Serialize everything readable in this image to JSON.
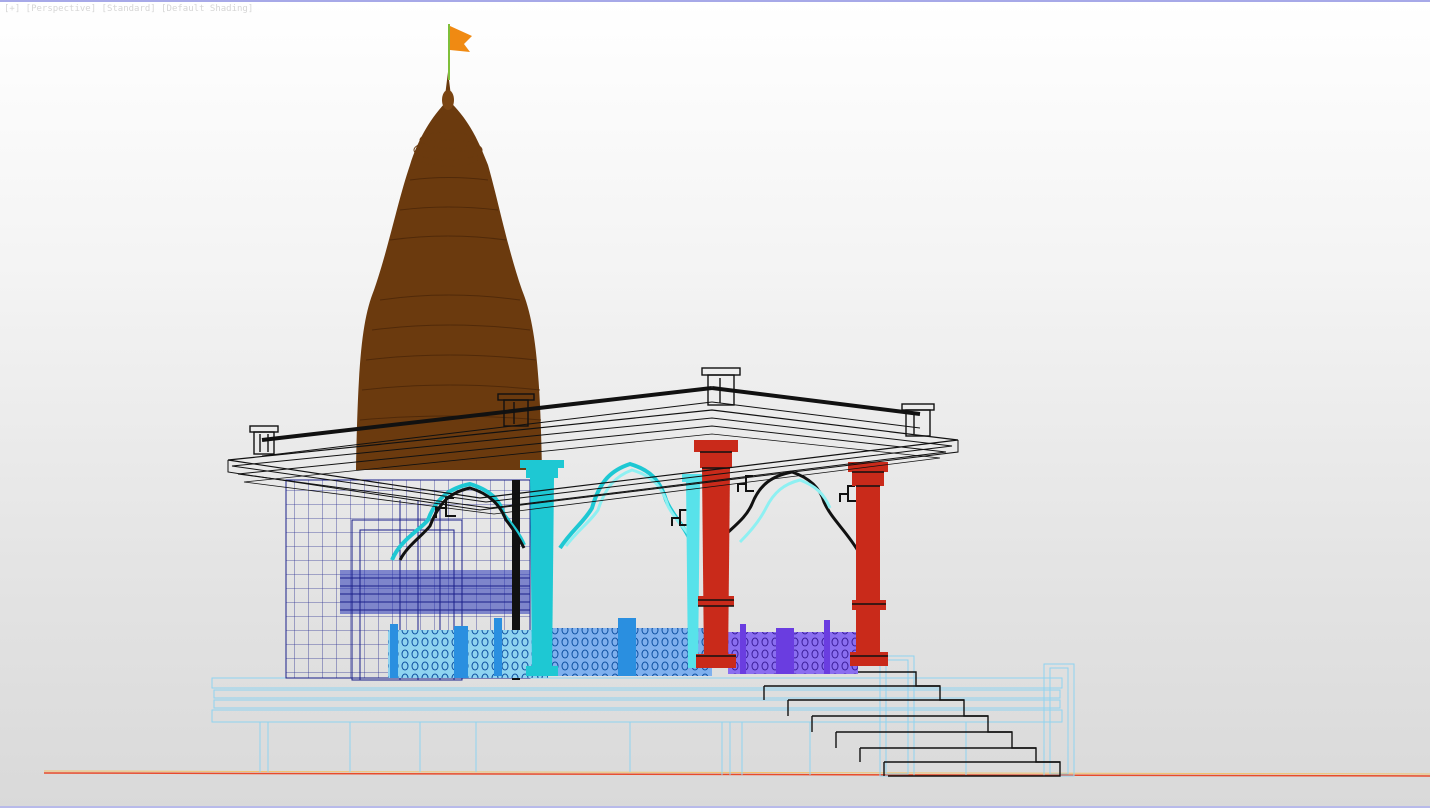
{
  "viewport": {
    "label": "[+] [Perspective] [Standard] [Default Shading]"
  },
  "scene": {
    "shikhara_color": "#6b3a0e",
    "flag_color": "#f08a12",
    "cyan_pillar_color": "#1ec8d3",
    "red_pillar_color": "#c92a1a",
    "blueprint_color": "#1a1f8a",
    "base_color": "#8fd3f0",
    "railing_blue": "#2a8fe0",
    "railing_purple": "#6a3de0",
    "stair_color": "#111111",
    "ground_line_color": "#e84a2a"
  }
}
